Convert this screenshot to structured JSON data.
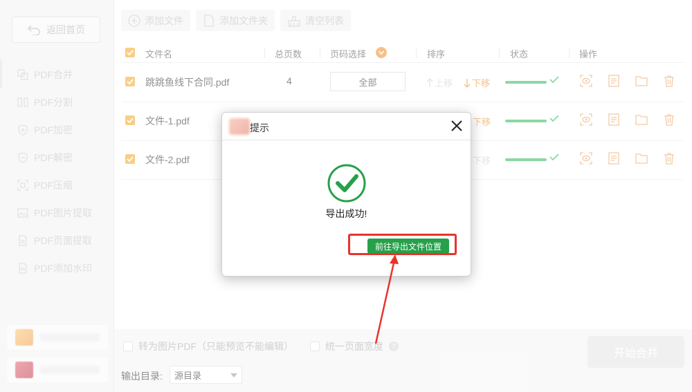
{
  "sidebar": {
    "back_label": "返回首页",
    "items": [
      {
        "label": "PDF合并",
        "icon": "merge-icon"
      },
      {
        "label": "PDF分割",
        "icon": "split-icon"
      },
      {
        "label": "PDF加密",
        "icon": "lock-shield-icon"
      },
      {
        "label": "PDF解密",
        "icon": "unlock-shield-icon"
      },
      {
        "label": "PDF压缩",
        "icon": "compress-icon"
      },
      {
        "label": "PDF图片提取",
        "icon": "image-icon"
      },
      {
        "label": "PDF页面提取",
        "icon": "page-icon"
      },
      {
        "label": "PDF添加水印",
        "icon": "watermark-icon"
      }
    ]
  },
  "toolbar": {
    "add_file": "添加文件",
    "add_folder": "添加文件夹",
    "clear_list": "清空列表"
  },
  "table": {
    "headers": {
      "filename": "文件名",
      "pages": "总页数",
      "page_select": "页码选择",
      "sort": "排序",
      "status": "状态",
      "actions": "操作"
    },
    "rows": [
      {
        "name": "跳跳鱼线下合同.pdf",
        "pages": "4",
        "page_select": "全部",
        "up": "上移",
        "down": "下移"
      },
      {
        "name": "文件-1.pdf",
        "pages": "",
        "page_select": "",
        "up": "",
        "down": "下移"
      },
      {
        "name": "文件-2.pdf",
        "pages": "",
        "page_select": "",
        "up": "",
        "down": "下移"
      }
    ]
  },
  "bottom": {
    "to_image_pdf": "转为图片PDF（只能预览不能编辑）",
    "uniform_width": "统一页面宽度",
    "help": "?",
    "start_merge": "开始合并",
    "output_dir_label": "输出目录:",
    "output_dir_value": "源目录"
  },
  "dialog": {
    "title": "提示",
    "message": "导出成功!",
    "goto_button": "前往导出文件位置"
  },
  "colors": {
    "accent_orange": "#f5a623",
    "success_green": "#27a04a",
    "annotation_red": "#e8332b"
  }
}
